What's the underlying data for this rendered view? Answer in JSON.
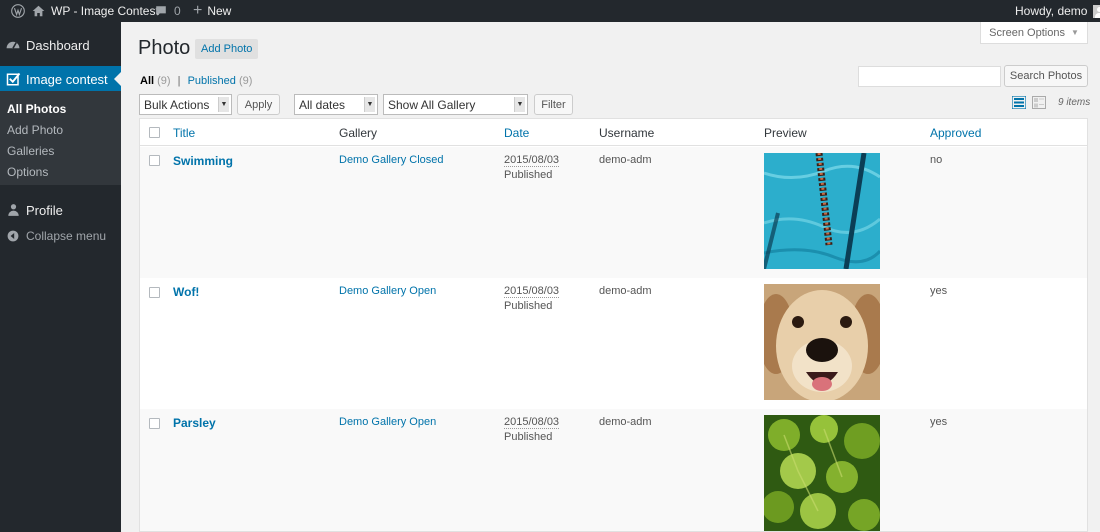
{
  "adminbar": {
    "site_name": "WP - Image Contest",
    "comments_count": "0",
    "new_label": "New",
    "greeting": "Howdy, demo"
  },
  "menu": {
    "dashboard": "Dashboard",
    "image_contest": "Image contest",
    "submenu": [
      "All Photos",
      "Add Photo",
      "Galleries",
      "Options"
    ],
    "profile": "Profile",
    "collapse": "Collapse menu"
  },
  "page": {
    "title": "Photo",
    "add_new": "Add Photo",
    "screen_options": "Screen Options",
    "views": {
      "all": "All",
      "all_count": "(9)",
      "separator": "|",
      "published": "Published",
      "published_count": "(9)"
    },
    "bulk_actions": "Bulk Actions",
    "apply": "Apply",
    "dates": "All dates",
    "gallery_filter": "Show All Gallery",
    "filter": "Filter",
    "search_button": "Search Photos",
    "search_value": "",
    "items_count": "9 items"
  },
  "table": {
    "columns": [
      "Title",
      "Gallery",
      "Date",
      "Username",
      "Preview",
      "Approved"
    ],
    "rows": [
      {
        "title": "Swimming",
        "gallery": "Demo Gallery Closed",
        "date": "2015/08/03",
        "status": "Published",
        "username": "demo-adm",
        "preview": "pool-lane-photo",
        "approved": "no"
      },
      {
        "title": "Wof!",
        "gallery": "Demo Gallery Open",
        "date": "2015/08/03",
        "status": "Published",
        "username": "demo-adm",
        "preview": "dog-photo",
        "approved": "yes"
      },
      {
        "title": "Parsley",
        "gallery": "Demo Gallery Open",
        "date": "2015/08/03",
        "status": "Published",
        "username": "demo-adm",
        "preview": "parsley-photo",
        "approved": "yes"
      }
    ]
  },
  "colors": {
    "admin_bar": "#23282d",
    "accent": "#0073aa",
    "link": "#0073aa"
  }
}
